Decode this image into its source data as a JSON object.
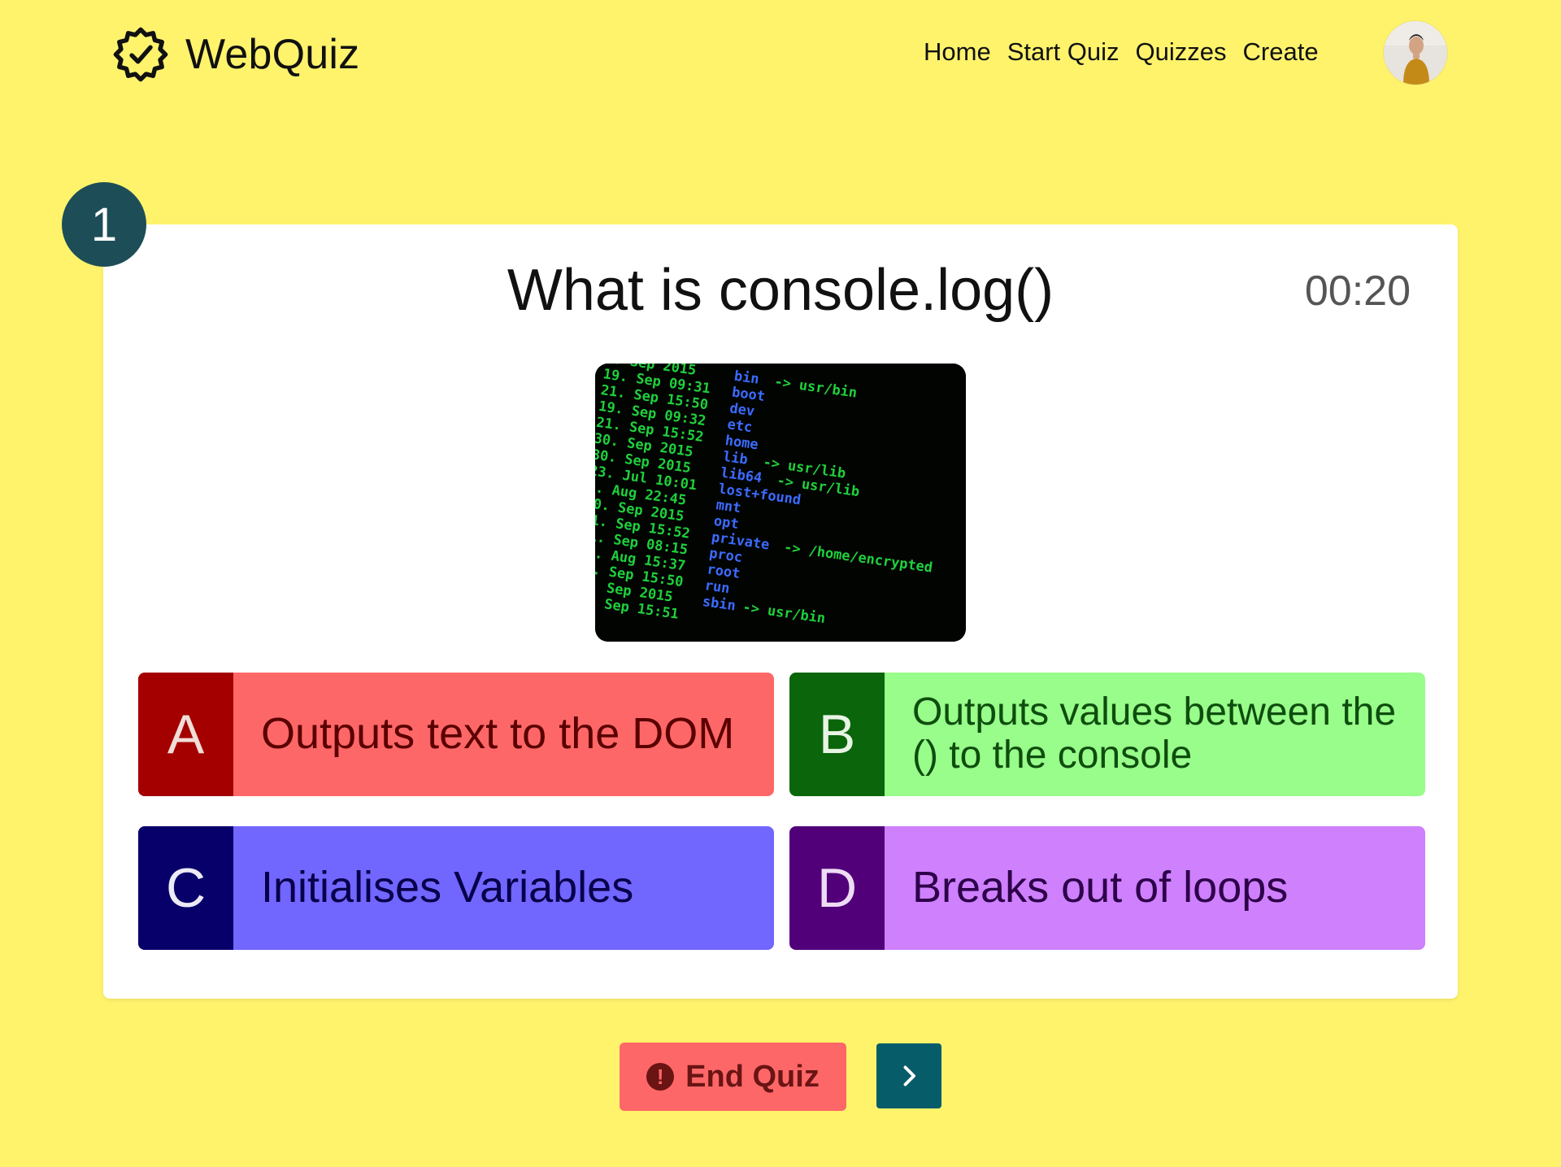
{
  "header": {
    "brand": "WebQuiz",
    "nav": [
      "Home",
      "Start Quiz",
      "Quizzes",
      "Create"
    ]
  },
  "quiz": {
    "question_number": "1",
    "question": "What is console.log()",
    "timer": "00:20",
    "answers": [
      {
        "letter": "A",
        "text": "Outputs text to the DOM"
      },
      {
        "letter": "B",
        "text": "Outputs values between the () to the console"
      },
      {
        "letter": "C",
        "text": "Initialises Variables"
      },
      {
        "letter": "D",
        "text": "Breaks out of loops"
      }
    ]
  },
  "controls": {
    "end_quiz": "End Quiz",
    "alert_symbol": "!"
  },
  "colors": {
    "page_bg": "#fff36c",
    "accent": "#1d4d57",
    "next_button": "#075c6a",
    "answer_a": "#fe6767",
    "answer_b": "#98fd8a",
    "answer_c": "#7166fe",
    "answer_d": "#ce80fd"
  },
  "icons": {
    "logo": "badge-check-icon",
    "end_quiz": "alert-circle-icon",
    "next": "chevron-right-icon"
  }
}
